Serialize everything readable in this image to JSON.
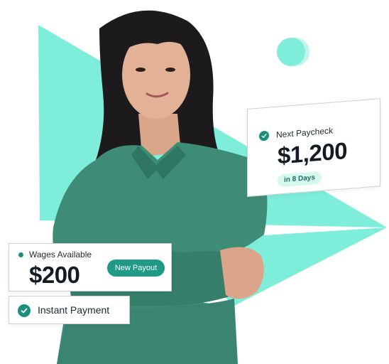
{
  "colors": {
    "mint": "#7eeedb",
    "teal": "#1b8f7c",
    "shirt": "#3f8c76",
    "badge_bg": "#d6f8ef"
  },
  "next_paycheck": {
    "icon": "check-circle-icon",
    "label": "Next Paycheck",
    "amount": "$1,200",
    "badge": "in 8 Days"
  },
  "wages": {
    "label": "Wages Available",
    "amount": "$200",
    "button": "New Payout"
  },
  "instant": {
    "icon": "check-circle-icon",
    "label": "Instant Payment"
  }
}
